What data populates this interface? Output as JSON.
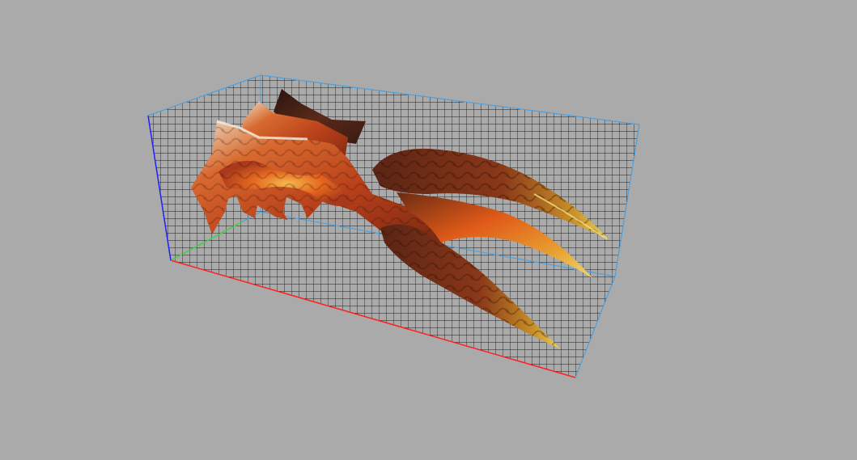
{
  "viewer": {
    "background_color": "#aaaaaa",
    "grid_color": "#1e1e1e",
    "bounding_box": "visible",
    "axes": {
      "x_color": "#ff2020",
      "y_color": "#40d040",
      "z_color": "#2020ff",
      "edge_color": "#4aa0e0"
    },
    "model": {
      "icon": "dragon-claw-gauntlet-model",
      "palette": {
        "dark": "#3a1a12",
        "mid": "#b8401a",
        "bright": "#e86a20",
        "glow": "#f0b040",
        "tip": "#e8d060",
        "scale": "#6a2a14"
      }
    }
  }
}
